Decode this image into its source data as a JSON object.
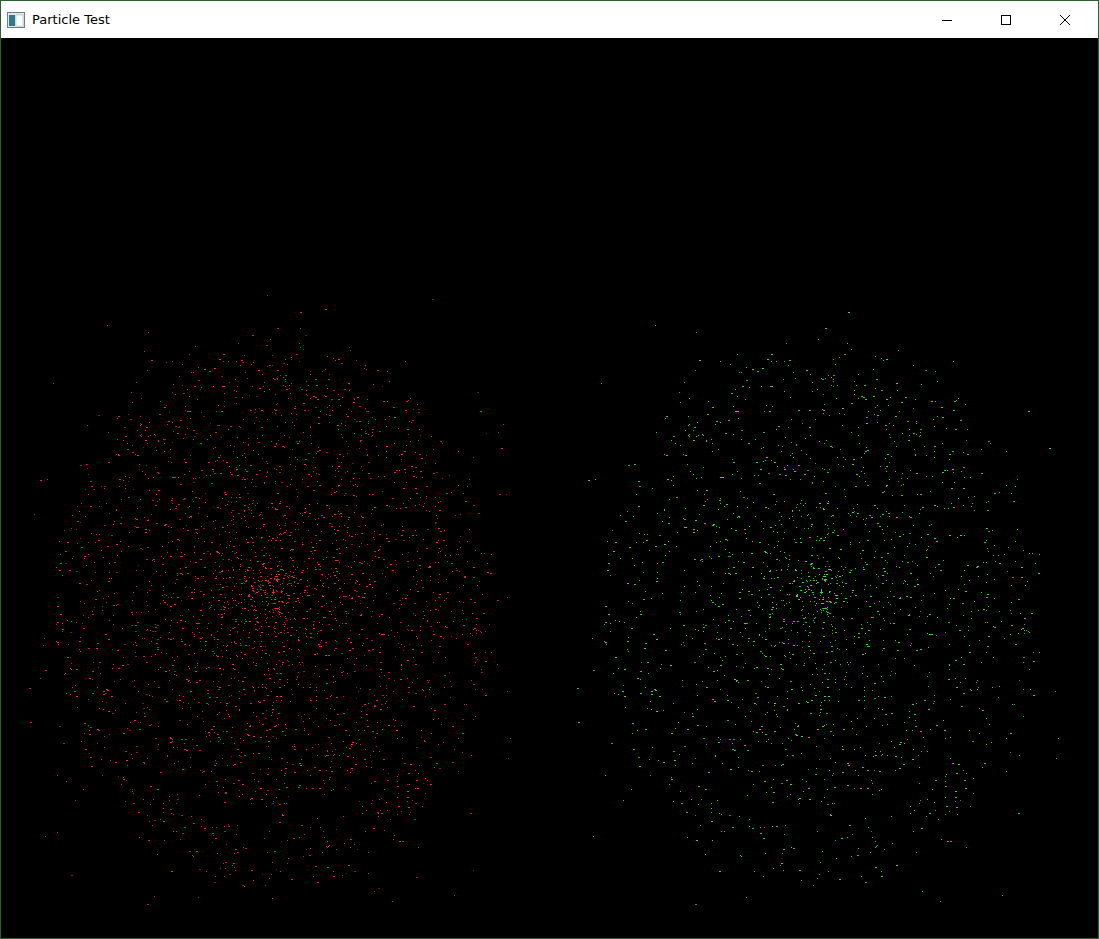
{
  "window": {
    "title": "Particle Test"
  },
  "emitters": [
    {
      "color": "#ff2a2a"
    },
    {
      "color": "#3cd93c"
    }
  ]
}
